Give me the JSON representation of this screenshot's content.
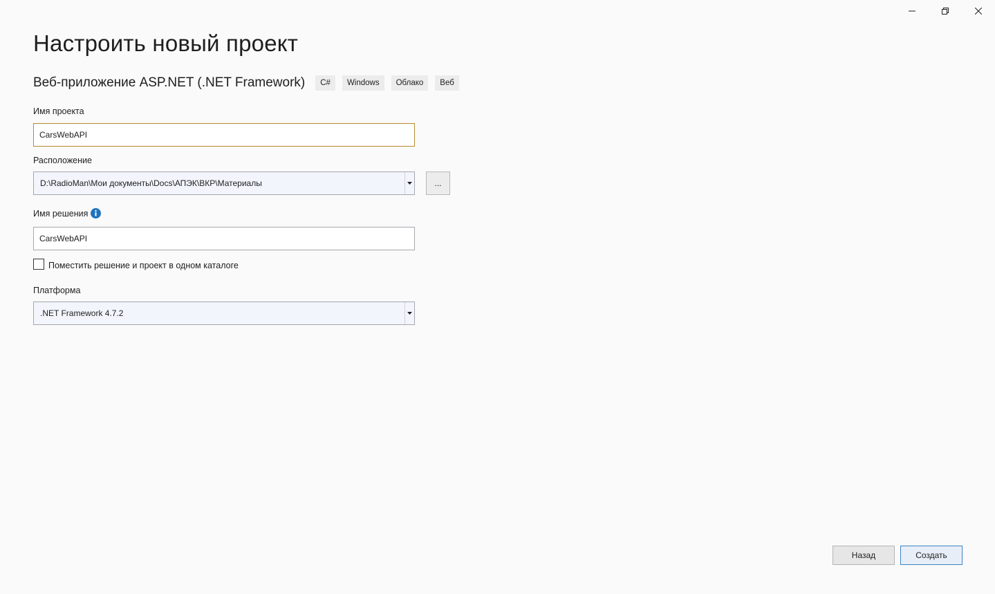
{
  "window_controls": {
    "minimize_icon": "minimize-icon",
    "restore_icon": "restore-icon",
    "close_icon": "close-icon"
  },
  "page": {
    "title": "Настроить новый проект"
  },
  "template": {
    "name": "Веб-приложение ASP.NET (.NET Framework)",
    "tags": [
      "C#",
      "Windows",
      "Облако",
      "Веб"
    ]
  },
  "form": {
    "project_name": {
      "label": "Имя проекта",
      "value": "CarsWebAPI"
    },
    "location": {
      "label": "Расположение",
      "value": "D:\\RadioMan\\Мои документы\\Docs\\АПЭК\\ВКР\\Материалы",
      "browse_label": "..."
    },
    "solution_name": {
      "label": "Имя решения",
      "value": "CarsWebAPI",
      "info_icon": "info-icon"
    },
    "same_dir": {
      "label": "Поместить решение и проект в одном каталоге",
      "checked": false
    },
    "framework": {
      "label": "Платформа",
      "value": ".NET Framework 4.7.2"
    }
  },
  "actions": {
    "back_label": "Назад",
    "create_label": "Создать"
  },
  "colors": {
    "focus_border": "#b58b2d",
    "info_blue": "#1e73be",
    "primary_border": "#3b82c4"
  }
}
